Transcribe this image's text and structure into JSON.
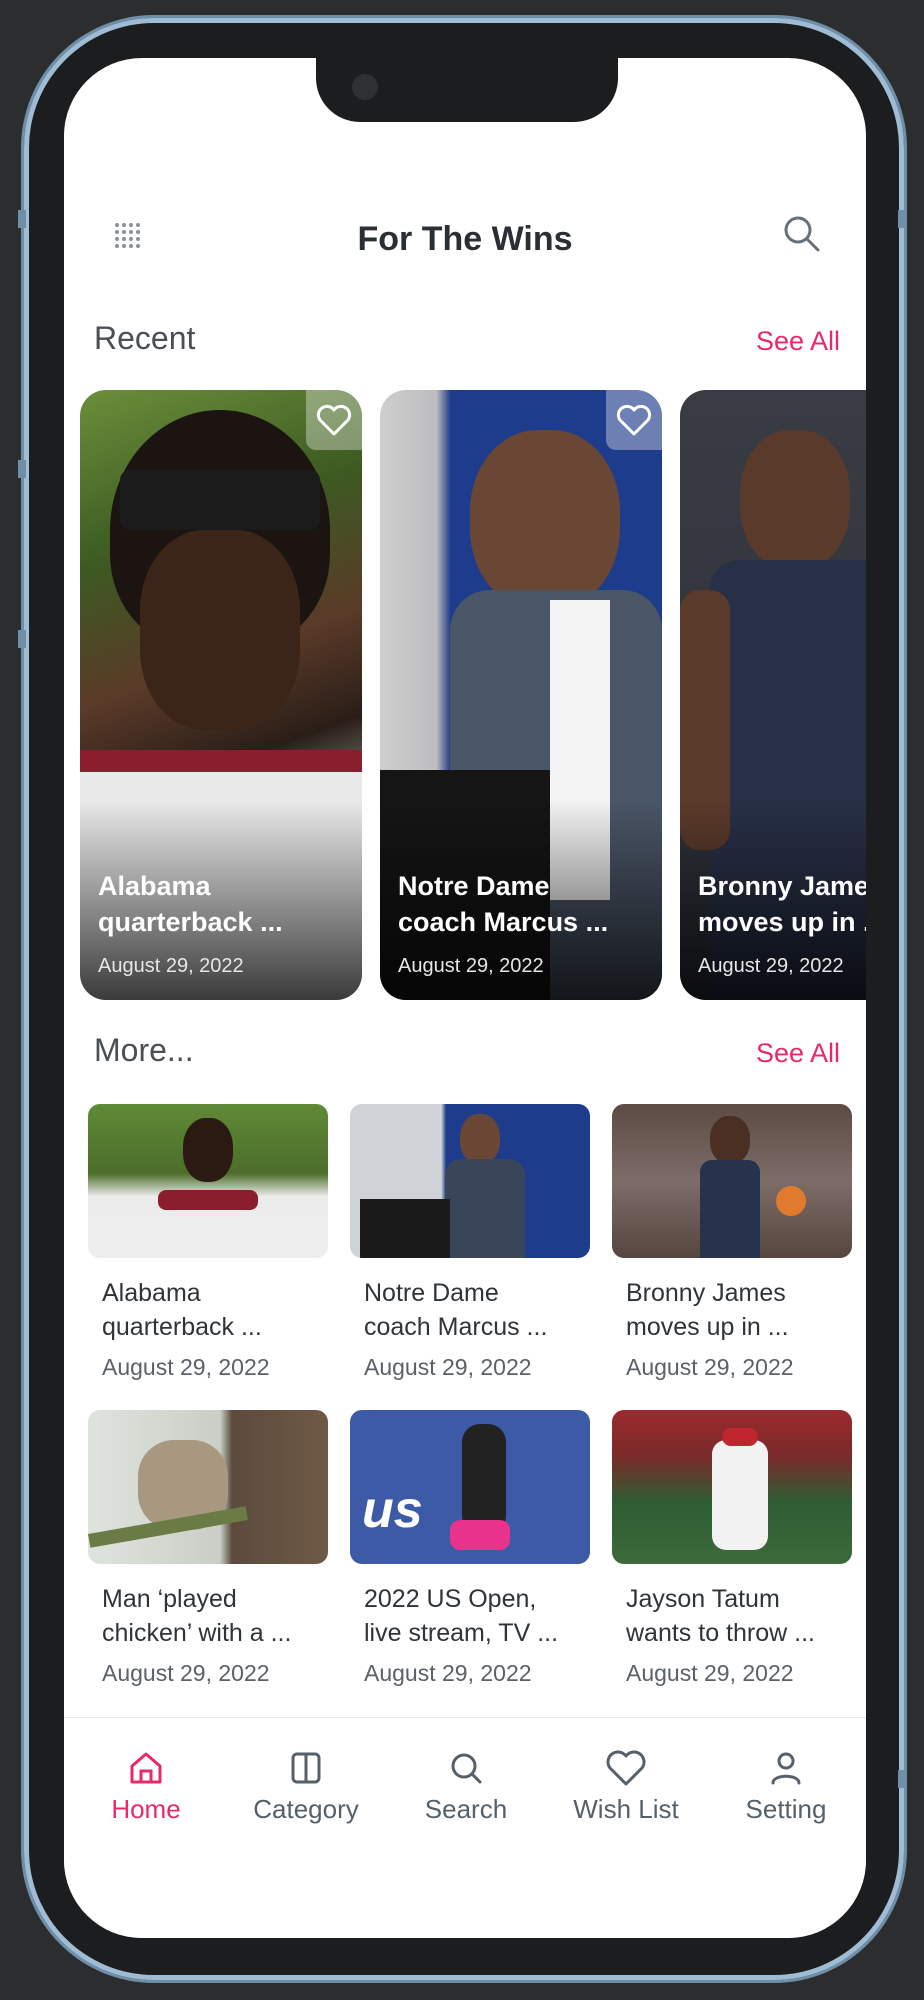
{
  "app": {
    "title": "For The Wins"
  },
  "colors": {
    "accent": "#e8296a",
    "text": "#2a2f35"
  },
  "recent": {
    "heading": "Recent",
    "see_all": "See All",
    "items": [
      {
        "title": "Alabama\nquarterback ...",
        "date": "August 29, 2022",
        "fav_icon": "heart-icon"
      },
      {
        "title": "Notre Dame\ncoach Marcus ...",
        "date": "August 29, 2022",
        "fav_icon": "heart-icon"
      },
      {
        "title": "Bronny James\nmoves up in ...",
        "date": "August 29, 2022"
      }
    ]
  },
  "more": {
    "heading": "More...",
    "see_all": "See All",
    "items": [
      {
        "title": "Alabama\nquarterback ...",
        "date": "August 29, 2022"
      },
      {
        "title": "Notre Dame\ncoach Marcus ...",
        "date": "August 29, 2022"
      },
      {
        "title": "Bronny James\nmoves up in ...",
        "date": "August 29, 2022"
      },
      {
        "title": "Man ‘played\nchicken’ with a ...",
        "date": "August 29, 2022"
      },
      {
        "title": "2022 US Open,\nlive stream, TV ...",
        "date": "August 29, 2022"
      },
      {
        "title": "Jayson Tatum\nwants to throw ...",
        "date": "August 29, 2022"
      }
    ]
  },
  "nav": [
    {
      "label": "Home",
      "icon": "home-icon",
      "active": true
    },
    {
      "label": "Category",
      "icon": "columns-icon"
    },
    {
      "label": "Search",
      "icon": "search-icon"
    },
    {
      "label": "Wish List",
      "icon": "heart-icon"
    },
    {
      "label": "Setting",
      "icon": "user-icon"
    }
  ]
}
